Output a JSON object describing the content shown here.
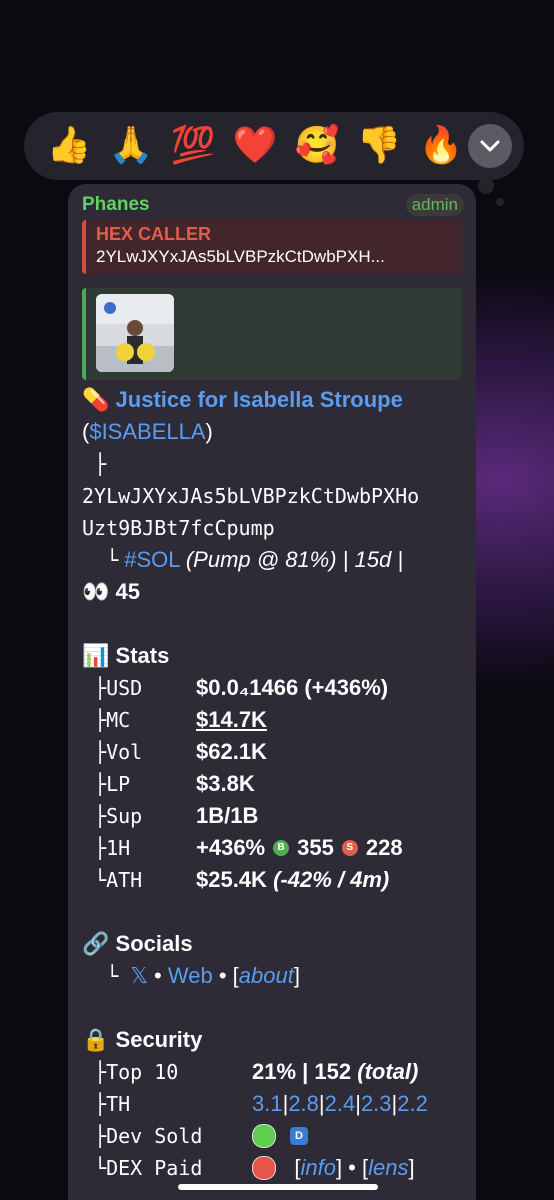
{
  "reactions": [
    "👍",
    "🙏",
    "💯",
    "❤️",
    "🥰",
    "👎",
    "🔥"
  ],
  "message": {
    "sender": "Phanes",
    "badge": "admin",
    "reply": {
      "name": "HEX CALLER",
      "text": "2YLwJXYxJAs5bLVBPzkCtDwbPXH..."
    },
    "token_emoji": "💊",
    "token_name": "Justice for Isabella Stroupe",
    "ticker_open": "(",
    "ticker": "$ISABELLA",
    "ticker_close": ")",
    "tree_branch": "├",
    "address_1": "2YLwJXYxJAs5bLVBPzkCtDwbPXHo",
    "address_2": "Uzt9BJBt7fcCpump",
    "tree_end": "└",
    "chain": "#SOL",
    "pump_info": "(Pump @ 81%) | 15d |",
    "eyes_emoji": "👀",
    "eyes_count": "45",
    "stats_title": "Stats",
    "stats_emoji": "📊",
    "stats": [
      {
        "prefix": "├",
        "key": "USD",
        "value": "$0.0₄1466 (+436%)"
      },
      {
        "prefix": "├",
        "key": "MC",
        "value": "$14.7K"
      },
      {
        "prefix": "├",
        "key": "Vol",
        "value": "$62.1K"
      },
      {
        "prefix": "├",
        "key": "LP",
        "value": "$3.8K"
      },
      {
        "prefix": "├",
        "key": "Sup",
        "value": "1B/1B"
      },
      {
        "prefix": "├",
        "key": "1H",
        "value": "+436%",
        "buys": "355",
        "sells": "228",
        "buy_letter": "B",
        "sell_letter": "S"
      },
      {
        "prefix": "└",
        "key": "ATH",
        "value": "$25.4K",
        "extra": "(-42% / 4m)"
      }
    ],
    "socials_title": "Socials",
    "socials_emoji": "🔗",
    "socials": {
      "prefix": "└",
      "x": "𝕏",
      "sep": "•",
      "web": "Web",
      "about_open": "[",
      "about": "about",
      "about_close": "]"
    },
    "security_title": "Security",
    "security_emoji": "🔒",
    "security": {
      "top10_key": "Top 10",
      "top10_val": "21% | 152",
      "top10_extra": "(total)",
      "th_key": "TH",
      "th_vals": [
        "3.1",
        "2.8",
        "2.4",
        "2.3",
        "2.2"
      ],
      "th_sep": "|",
      "dev_key": "Dev Sold",
      "dev_badge": "D",
      "dex_key": "DEX Paid",
      "info": "info",
      "lens": "lens"
    }
  },
  "colors": {
    "accent": "#5a9cf0",
    "green": "#5fd35f",
    "red": "#e05e4a"
  }
}
